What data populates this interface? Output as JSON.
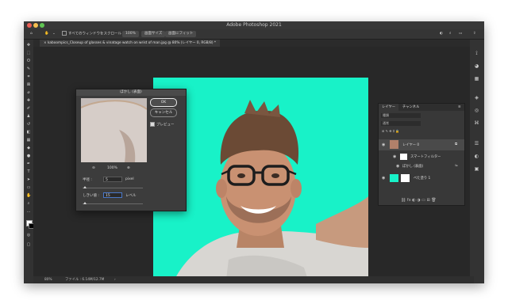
{
  "window": {
    "app_title": "Adobe Photoshop 2021",
    "doc_tab": "kaboompics_Closeup of glasses & vinatage watch on wrist of man.jpg @ 80% (レイヤー 0, RGB/8) *"
  },
  "options_bar": {
    "scroll_all_windows": "すべてのウィンドウをスクロール",
    "zoom_100": "100%",
    "fit_screen": "画面サイズ",
    "fill_screen": "画面にフィット"
  },
  "status": {
    "zoom": "80%",
    "file_info": "ファイル : 6.14M/12.7M"
  },
  "layers_panel": {
    "tab_layers": "レイヤー",
    "tab_channels": "チャンネル",
    "filter_placeholder": "種類",
    "blend_mode": "通常",
    "layer0_name": "レイヤー 0",
    "smart_filter": "スマートフィルター",
    "filter_name": "ぼかし (表面)",
    "fill_layer_name": "べた塗り 1"
  },
  "dialog": {
    "title": "ぼかし (表面)",
    "ok": "OK",
    "cancel": "キャンセル",
    "preview_label": "プレビュー",
    "zoom_value": "100%",
    "radius_label": "半径 :",
    "radius_value": "5",
    "radius_unit": "pixel",
    "threshold_label": "しきい値 :",
    "threshold_value": "15",
    "threshold_unit": "レベル"
  },
  "colors": {
    "background_fill": "#18f2c8",
    "ui_dark": "#262626"
  }
}
